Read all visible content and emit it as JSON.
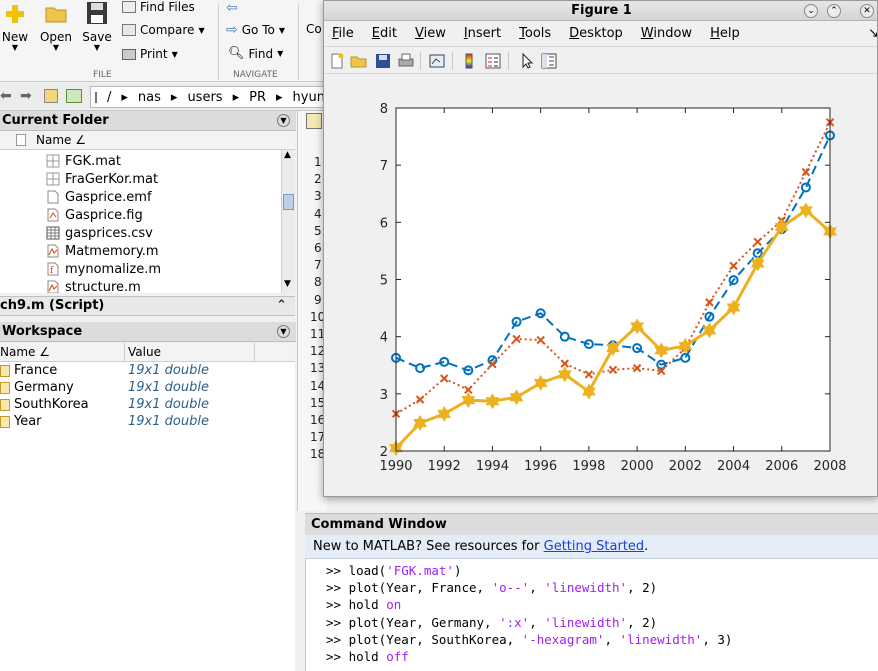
{
  "toolstrip": {
    "new": "New",
    "open": "Open",
    "save": "Save",
    "find_files": "Find Files",
    "compare": "Compare",
    "print": "Print",
    "go_to": "Go To",
    "find": "Find",
    "comment": "Co",
    "file_section": "FILE",
    "navigate_section": "NAVIGATE"
  },
  "path": {
    "root": "/",
    "segments": [
      "nas",
      "users",
      "PR",
      "hyunch"
    ]
  },
  "current_folder": {
    "title": "Current Folder",
    "name_header": "Name ∠",
    "files": [
      "FGK.mat",
      "FraGerKor.mat",
      "Gasprice.emf",
      "Gasprice.fig",
      "gasprices.csv",
      "Matmemory.m",
      "mynomalize.m",
      "structure.m"
    ]
  },
  "script_bar": "ch9.m  (Script)",
  "workspace": {
    "title": "Workspace",
    "name_header": "Name ∠",
    "value_header": "Value",
    "vars": [
      {
        "name": "France",
        "value": "19x1 double"
      },
      {
        "name": "Germany",
        "value": "19x1 double"
      },
      {
        "name": "SouthKorea",
        "value": "19x1 double"
      },
      {
        "name": "Year",
        "value": "19x1 double"
      }
    ]
  },
  "editor_lines": [
    "1",
    "2",
    "3",
    "4",
    "5",
    "6",
    "7",
    "8",
    "9",
    "10",
    "11",
    "12",
    "13",
    "14",
    "15",
    "16",
    "17",
    "18"
  ],
  "command_window": {
    "title": "Command Window",
    "tip_prefix": "New to MATLAB? See resources for ",
    "tip_link": "Getting Started",
    "tip_suffix": ".",
    "lines": [
      {
        "prompt": ">> ",
        "code": "load(",
        "str1": "'FGK.mat'",
        "rest1": ")",
        "str2": "",
        "rest2": "",
        "str3": "",
        "rest3": ""
      },
      {
        "prompt": ">> ",
        "code": "plot(Year, France, ",
        "str1": "'o--'",
        "rest1": ", ",
        "str2": "'linewidth'",
        "rest2": ", 2)",
        "str3": "",
        "rest3": ""
      },
      {
        "prompt": ">> ",
        "code": "hold ",
        "str1": "on",
        "rest1": "",
        "str2": "",
        "rest2": "",
        "str3": "",
        "rest3": ""
      },
      {
        "prompt": ">> ",
        "code": "plot(Year, Germany, ",
        "str1": "':x'",
        "rest1": ", ",
        "str2": "'linewidth'",
        "rest2": ", 2)",
        "str3": "",
        "rest3": ""
      },
      {
        "prompt": ">> ",
        "code": "plot(Year, SouthKorea, ",
        "str1": "'-hexagram'",
        "rest1": ", ",
        "str2": "'linewidth'",
        "rest2": ", 3)",
        "str3": "",
        "rest3": ""
      },
      {
        "prompt": ">> ",
        "code": "hold ",
        "str1": "off",
        "rest1": "",
        "str2": "",
        "rest2": "",
        "str3": "",
        "rest3": ""
      }
    ]
  },
  "figure": {
    "title": "Figure 1",
    "menu": [
      "File",
      "Edit",
      "View",
      "Insert",
      "Tools",
      "Desktop",
      "Window",
      "Help"
    ],
    "minimize_glyph": "⌄",
    "restore_glyph": "⌃",
    "close_glyph": "✕",
    "menu_arrow": "↘"
  },
  "colors": {
    "france": "#0072BD",
    "germany": "#D95319",
    "korea": "#EDB120"
  },
  "chart_data": {
    "type": "line",
    "x": [
      1990,
      1991,
      1992,
      1993,
      1994,
      1995,
      1996,
      1997,
      1998,
      1999,
      2000,
      2001,
      2002,
      2003,
      2004,
      2005,
      2006,
      2007,
      2008
    ],
    "xlim": [
      1990,
      2008
    ],
    "ylim": [
      2,
      8
    ],
    "xticks": [
      1990,
      1992,
      1994,
      1996,
      1998,
      2000,
      2002,
      2004,
      2006,
      2008
    ],
    "yticks": [
      2,
      3,
      4,
      5,
      6,
      7,
      8
    ],
    "series": [
      {
        "marker": "o",
        "style": "dashed",
        "width": 2,
        "color": "#0072BD",
        "values": [
          3.63,
          3.45,
          3.56,
          3.41,
          3.59,
          4.26,
          4.41,
          4.0,
          3.87,
          3.85,
          3.8,
          3.51,
          3.63,
          4.35,
          4.99,
          5.46,
          5.88,
          6.61,
          7.52
        ]
      },
      {
        "marker": "x",
        "style": "dotted",
        "width": 2,
        "color": "#D95319",
        "values": [
          2.65,
          2.9,
          3.27,
          3.07,
          3.52,
          3.96,
          3.94,
          3.53,
          3.34,
          3.42,
          3.45,
          3.4,
          3.8,
          4.6,
          5.24,
          5.66,
          6.03,
          6.88,
          7.75
        ]
      },
      {
        "marker": "hexagram",
        "style": "solid",
        "width": 3,
        "color": "#EDB120",
        "values": [
          2.05,
          2.49,
          2.65,
          2.89,
          2.87,
          2.94,
          3.19,
          3.34,
          3.04,
          3.8,
          4.18,
          3.76,
          3.84,
          4.11,
          4.51,
          5.28,
          5.92,
          6.21,
          5.84
        ]
      }
    ]
  }
}
